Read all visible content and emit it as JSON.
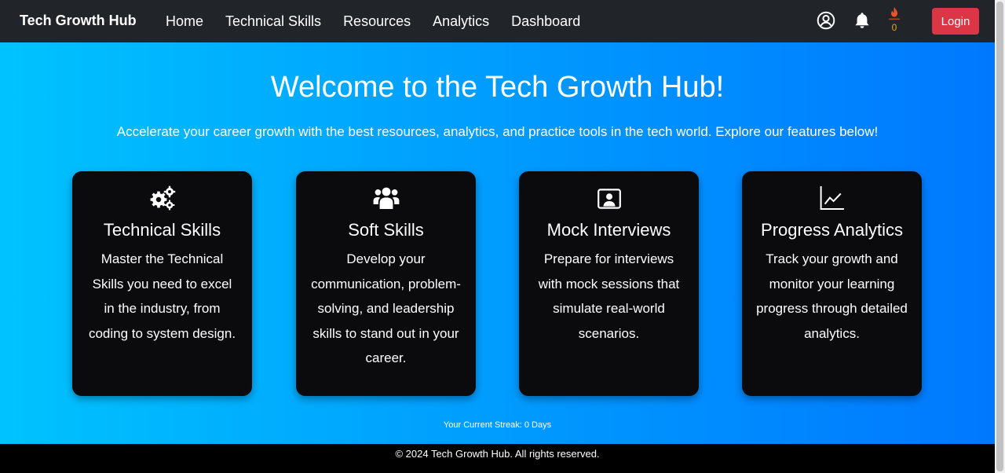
{
  "navbar": {
    "brand": "Tech Growth Hub",
    "links": [
      "Home",
      "Technical Skills",
      "Resources",
      "Analytics",
      "Dashboard"
    ],
    "streak_count": "0",
    "login_label": "Login"
  },
  "hero": {
    "title": "Welcome to the Tech Growth Hub!",
    "subtitle": "Accelerate your career growth with the best resources, analytics, and practice tools in the tech world. Explore our features below!"
  },
  "cards": [
    {
      "icon": "gears-icon",
      "title": "Technical Skills",
      "description": "Master the Technical Skills you need to excel in the industry, from coding to system design."
    },
    {
      "icon": "users-icon",
      "title": "Soft Skills",
      "description": "Develop your communication, problem-solving, and leadership skills to stand out in your career."
    },
    {
      "icon": "id-card-icon",
      "title": "Mock Interviews",
      "description": "Prepare for interviews with mock sessions that simulate real-world scenarios."
    },
    {
      "icon": "line-chart-icon",
      "title": "Progress Analytics",
      "description": "Track your growth and monitor your learning progress through detailed analytics."
    }
  ],
  "streak_text": "Your Current Streak: 0 Days",
  "footer_text": "© 2024 Tech Growth Hub. All rights reserved.",
  "colors": {
    "navbar_bg": "#212529",
    "hero_gradient_start": "#00c3fe",
    "hero_gradient_end": "#0078fe",
    "card_bg": "#0b0a0c",
    "login_bg": "#dc3545",
    "flame": "#f0a020"
  }
}
